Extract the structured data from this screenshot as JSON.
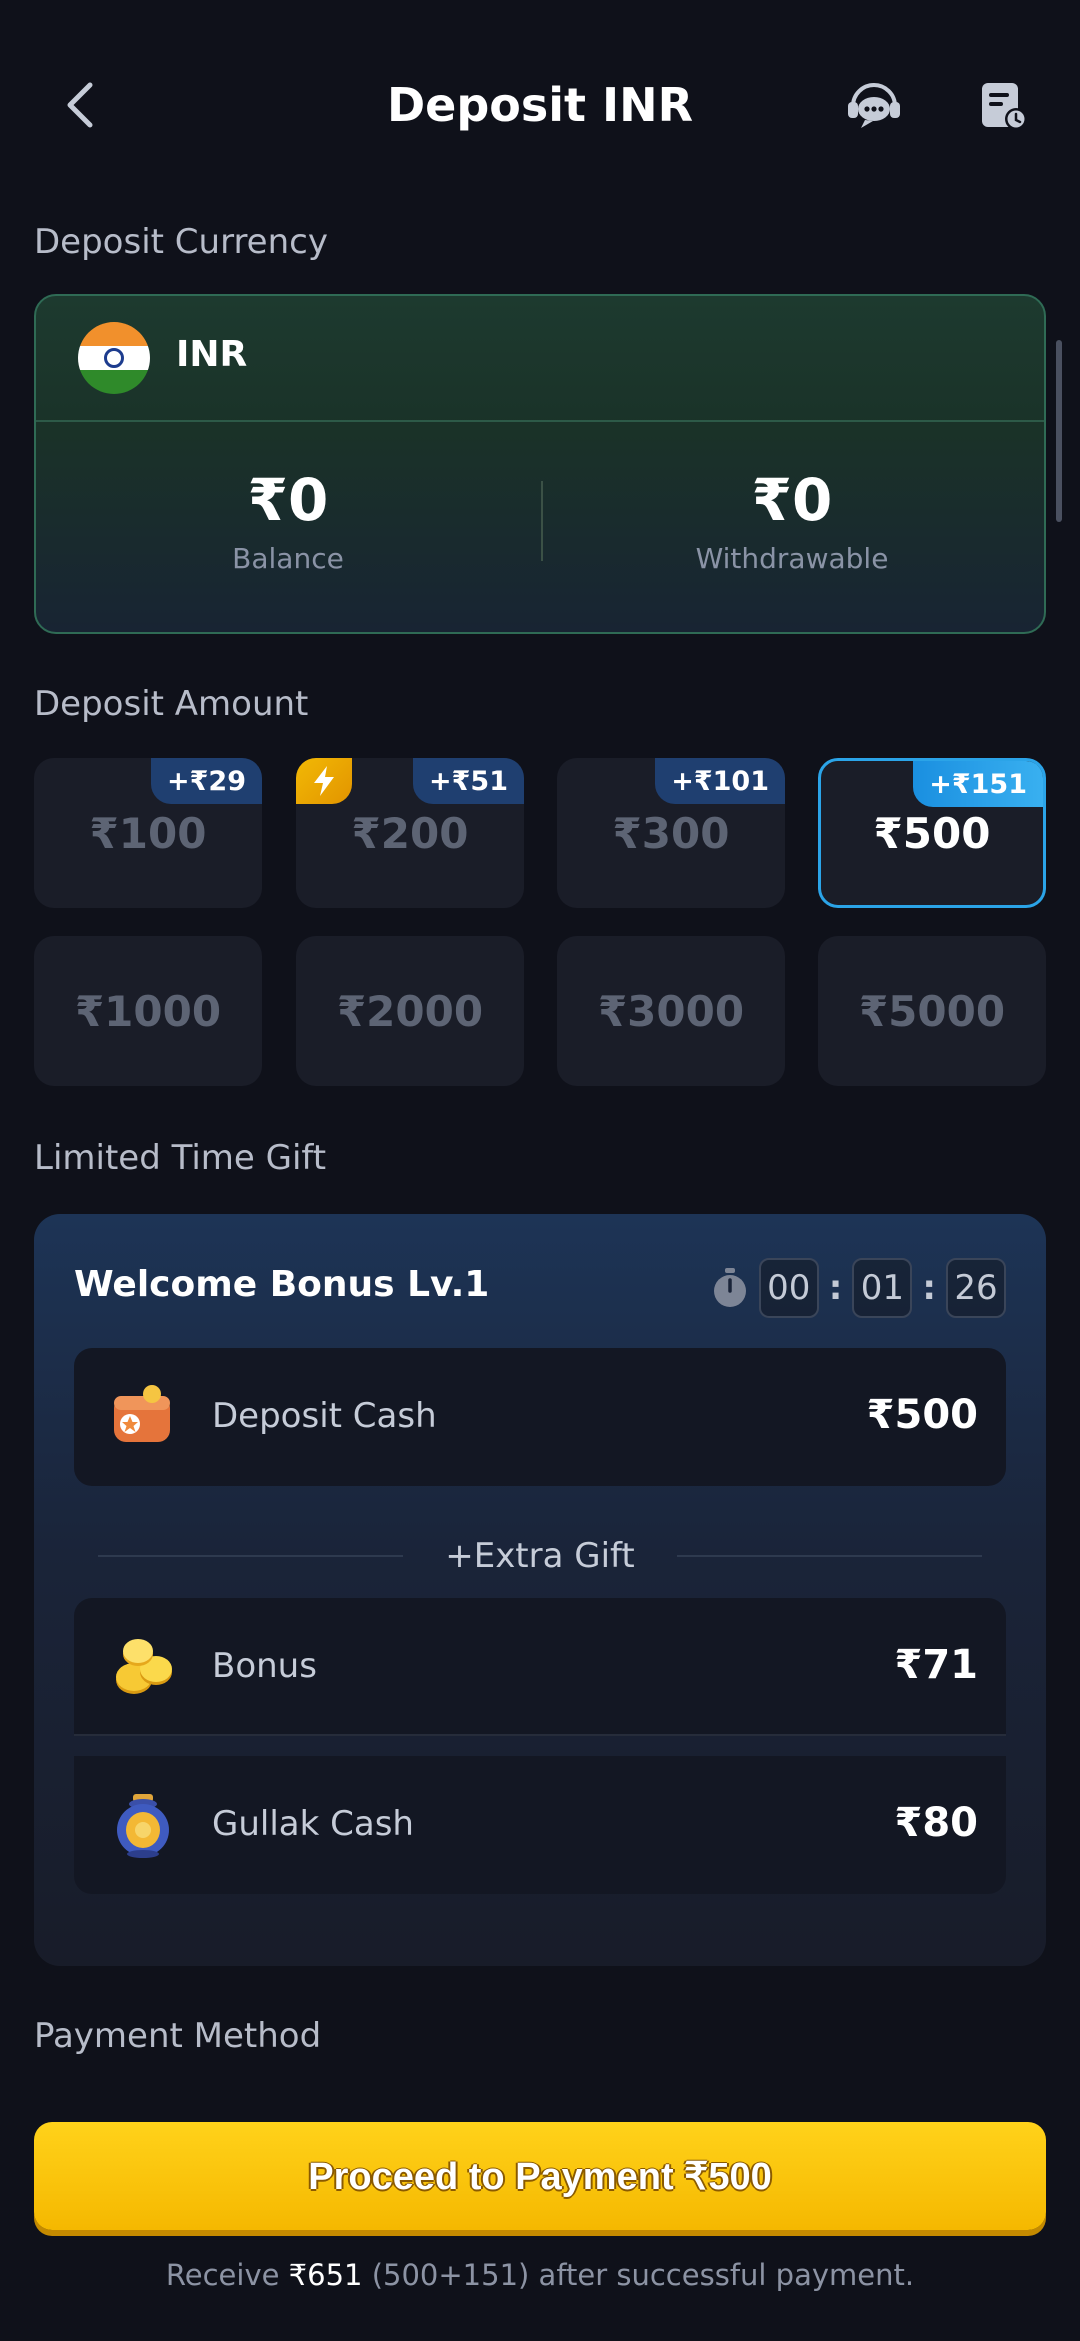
{
  "header": {
    "title": "Deposit INR",
    "back_icon": "chevron-left-icon",
    "support_icon": "support-chat-icon",
    "records_icon": "records-clock-icon"
  },
  "currency_section": {
    "label": "Deposit Currency",
    "code": "INR",
    "flag_icon": "india-flag-icon",
    "balance_value": "₹0",
    "balance_label": "Balance",
    "withdrawable_value": "₹0",
    "withdrawable_label": "Withdrawable"
  },
  "amount_section": {
    "label": "Deposit Amount",
    "options": [
      {
        "amount": "₹100",
        "badge": "+₹29",
        "selected": false
      },
      {
        "amount": "₹200",
        "badge": "+₹51",
        "selected": false,
        "flash": true
      },
      {
        "amount": "₹300",
        "badge": "+₹101",
        "selected": false
      },
      {
        "amount": "₹500",
        "badge": "+₹151",
        "selected": true
      },
      {
        "amount": "₹1000",
        "badge": "",
        "selected": false
      },
      {
        "amount": "₹2000",
        "badge": "",
        "selected": false
      },
      {
        "amount": "₹3000",
        "badge": "",
        "selected": false
      },
      {
        "amount": "₹5000",
        "badge": "",
        "selected": false
      }
    ]
  },
  "gift_section": {
    "label": "Limited Time Gift",
    "title": "Welcome Bonus Lv.1",
    "timer": {
      "hours": "00",
      "minutes": "01",
      "seconds": "26",
      "separator": ":"
    },
    "deposit_cash_label": "Deposit Cash",
    "deposit_cash_value": "₹500",
    "extra_gift_label": "+Extra Gift",
    "bonus_label": "Bonus",
    "bonus_value": "₹71",
    "gullak_label": "Gullak Cash",
    "gullak_value": "₹80"
  },
  "payment_section": {
    "label": "Payment Method"
  },
  "footer": {
    "proceed_label": "Proceed to Payment ₹500",
    "receive_prefix": "Receive ",
    "receive_amount": "₹651",
    "receive_suffix": " (500+151) after successful payment."
  },
  "colors": {
    "background": "#0f111a",
    "accent_blue": "#2ba4e8",
    "proceed_yellow": "#ffc800",
    "currency_card_green": "#1d3a2f"
  }
}
